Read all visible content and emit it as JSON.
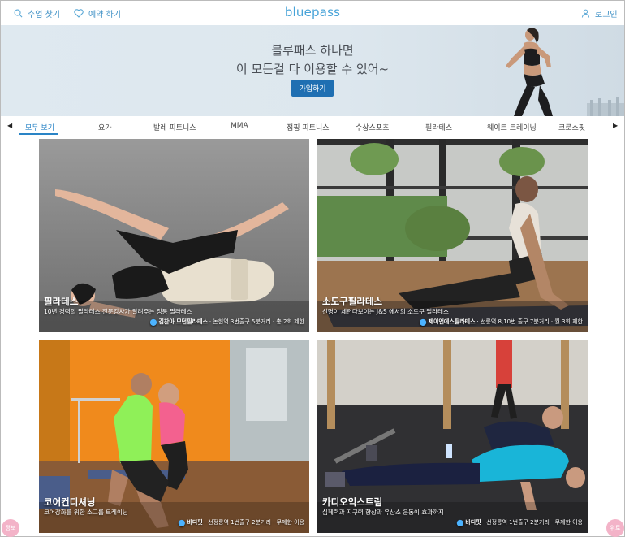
{
  "header": {
    "find_class_label": "수업 찾기",
    "favorites_label": "예약 하기",
    "logo_text": "bluepass",
    "login_label": "로그인"
  },
  "banner": {
    "line1": "블루패스 하나면",
    "line2": "이 모든걸 다 이용할 수 있어~",
    "join_label": "가입하기"
  },
  "categories": [
    {
      "label": "모두 보기",
      "active": true
    },
    {
      "label": "요가"
    },
    {
      "label": "발레 피트니스"
    },
    {
      "label": "MMA"
    },
    {
      "label": "점핑 피트니스"
    },
    {
      "label": "수상스포츠"
    },
    {
      "label": "필라테스"
    },
    {
      "label": "웨이트 트레이닝"
    },
    {
      "label": "크로스핏"
    }
  ],
  "cards": [
    {
      "title": "필라테스",
      "desc": "10년 경력의 필라테스 전문강사가 알려주는 정통 필라테스",
      "place": "김찬아 모던필라테스",
      "loc": " · 논현역 3번출구 5분거리 · 총 2회 제한"
    },
    {
      "title": "소도구필라테스",
      "desc": "선명이 세련다보이는 J&S 에서의 소도구 필라테스",
      "place": "제이앤에스필라테스",
      "loc": " · 선릉역 8,10번 출구 7분거리 · 월 3회 제한"
    },
    {
      "title": "코어컨디셔닝",
      "desc": "코어강화를 위한 소그룹 트레이닝",
      "place": "바디핏",
      "loc": " · 선정릉역 1번출구 2분거리 · 무제한 이용"
    },
    {
      "title": "카디오익스트림",
      "desc": "심폐력과 지구력 향상과 유산소 운동이 효과까지",
      "place": "바디핏",
      "loc": " · 선정릉역 1번출구 2분거리 · 무제한 이용"
    }
  ],
  "float": {
    "left_label": "정보",
    "right_label": "위로"
  },
  "colors": {
    "brand": "#47a3d8",
    "button": "#1f6fb2",
    "active_tab": "#2a84c6",
    "float_button": "#f3b3c8"
  },
  "icons": {
    "search": "search-icon",
    "heart": "heart-icon",
    "user": "user-icon",
    "pin": "location-pin-icon",
    "prev": "arrow-left-icon",
    "next": "arrow-right-icon"
  }
}
